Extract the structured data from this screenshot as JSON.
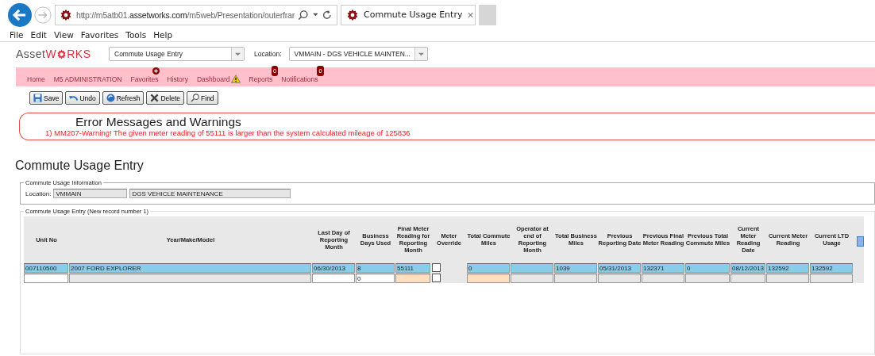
{
  "browser": {
    "address": {
      "prefix": "http://m5atb01.",
      "domain": "assetworks.com",
      "path": "/m5web/Presentation/outerfrar"
    },
    "tab": {
      "title": "Commute Usage Entry",
      "close": "×"
    },
    "menu": [
      "File",
      "Edit",
      "View",
      "Favorites",
      "Tools",
      "Help"
    ]
  },
  "app": {
    "logo": {
      "plain": "Asset",
      "accent_before": "W",
      "accent_after": "RKS"
    },
    "screen_select": "Commute Usage Entry",
    "location_label": "Location:",
    "location_select": "VMMAIN - DGS VEHICLE MAINTEN..."
  },
  "nav": [
    {
      "label": "Home"
    },
    {
      "label": "M5 ADMINISTRATION"
    },
    {
      "label": "Favorites",
      "kind": "plus"
    },
    {
      "label": "History"
    },
    {
      "label": "Dashboard",
      "kind": "warning"
    },
    {
      "label": "Reports",
      "kind": "count",
      "count": "0"
    },
    {
      "label": "Notifications",
      "kind": "count",
      "count": "0"
    }
  ],
  "toolbar": [
    "Save",
    "Undo",
    "Refresh",
    "Delete",
    "Find"
  ],
  "errors": {
    "title": "Error Messages and Warnings",
    "messages": [
      "1) MM207-Warning! The given meter reading of 55111 is larger than the system calculated mileage of 125836"
    ]
  },
  "page_title": "Commute Usage Entry",
  "info": {
    "legend": "Commute Usage Information",
    "location_label": "Location:",
    "location_code": "VMMAIN",
    "location_name": "DGS VEHICLE MAINTENANCE"
  },
  "entry": {
    "legend": "Commute Usage Entry (New record number 1)",
    "columns": [
      "Unit No",
      "Year/Make/Model",
      "Last Day of Reporting Month",
      "Business Days Used",
      "Final Meter Reading for Reporting Month",
      "Meter Override",
      "Total Commute Miles",
      "Operator at end of Reporting Month",
      "Total Business Miles",
      "Previous Reporting Date",
      "Previous Final Meter Reading",
      "Previous Total Commute Miles",
      "Current Meter Reading Date",
      "Current Meter Reading",
      "Current LTD Usage"
    ],
    "rows": [
      {
        "selected": true,
        "cells": [
          {
            "kind": "text",
            "value": "007110500"
          },
          {
            "kind": "text",
            "value": "2007 FORD EXPLORER"
          },
          {
            "kind": "text",
            "value": "06/30/2013"
          },
          {
            "kind": "text",
            "value": "8"
          },
          {
            "kind": "text",
            "value": "55111"
          },
          {
            "kind": "checkbox",
            "checked": false
          },
          {
            "kind": "text",
            "value": "0"
          },
          {
            "kind": "text"
          },
          {
            "kind": "text",
            "value": "1039"
          },
          {
            "kind": "text",
            "value": "05/31/2013"
          },
          {
            "kind": "text",
            "value": "132371"
          },
          {
            "kind": "text",
            "value": "0"
          },
          {
            "kind": "text",
            "value": "08/12/2013"
          },
          {
            "kind": "text",
            "value": "132592"
          },
          {
            "kind": "text",
            "value": "132592"
          }
        ]
      },
      {
        "selected": false,
        "cells": [
          {
            "kind": "text",
            "readonly": false,
            "required": false
          },
          {
            "kind": "text",
            "readonly": true,
            "required": false
          },
          {
            "kind": "text",
            "readonly": false,
            "required": false
          },
          {
            "kind": "text",
            "readonly": false,
            "required": false,
            "value": "0"
          },
          {
            "kind": "text",
            "readonly": false,
            "required": true
          },
          {
            "kind": "checkbox",
            "checked": false
          },
          {
            "kind": "text",
            "readonly": false,
            "required": true
          },
          {
            "kind": "text",
            "readonly": true,
            "required": false
          },
          {
            "kind": "text",
            "readonly": true,
            "required": false
          },
          {
            "kind": "text",
            "readonly": true,
            "required": false
          },
          {
            "kind": "text",
            "readonly": true,
            "required": false
          },
          {
            "kind": "text",
            "readonly": true,
            "required": false
          },
          {
            "kind": "text",
            "readonly": true,
            "required": false
          },
          {
            "kind": "text",
            "readonly": true,
            "required": false
          },
          {
            "kind": "text",
            "readonly": true,
            "required": false
          }
        ]
      }
    ]
  }
}
